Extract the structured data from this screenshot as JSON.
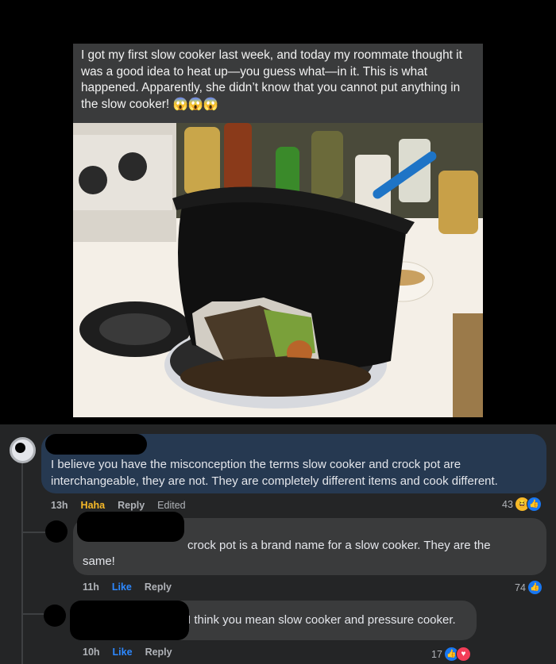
{
  "post": {
    "text": "I got my first slow cooker last week, and today my roommate thought it was a good idea to heat up—you guess what—in it. This is what happened. Apparently, she didn’t know that you cannot put anything in the slow cooker! 😱😱😱"
  },
  "comments": [
    {
      "text": "I believe you have the misconception the terms slow cooker and crock pot are interchangeable, they are not. They are completely different items and cook different.",
      "time": "13h",
      "reaction_action": "Haha",
      "reply": "Reply",
      "edited": "Edited",
      "reaction_count": "43"
    },
    {
      "text_line1": "crock pot is a brand name for a slow cooker. They are the",
      "text_line2": "same!",
      "time": "11h",
      "like": "Like",
      "reply": "Reply",
      "reaction_count": "74"
    },
    {
      "text": "I think you mean slow cooker and pressure cooker.",
      "time": "10h",
      "like": "Like",
      "reply": "Reply",
      "reaction_count": "17"
    }
  ],
  "colors": {
    "post_bg": "#000000",
    "comments_bg": "#242526",
    "bubble": "#3a3b3c",
    "highlight_bubble": "#263951",
    "like_blue": "#2d88ff",
    "haha_yellow": "#f7b928"
  }
}
